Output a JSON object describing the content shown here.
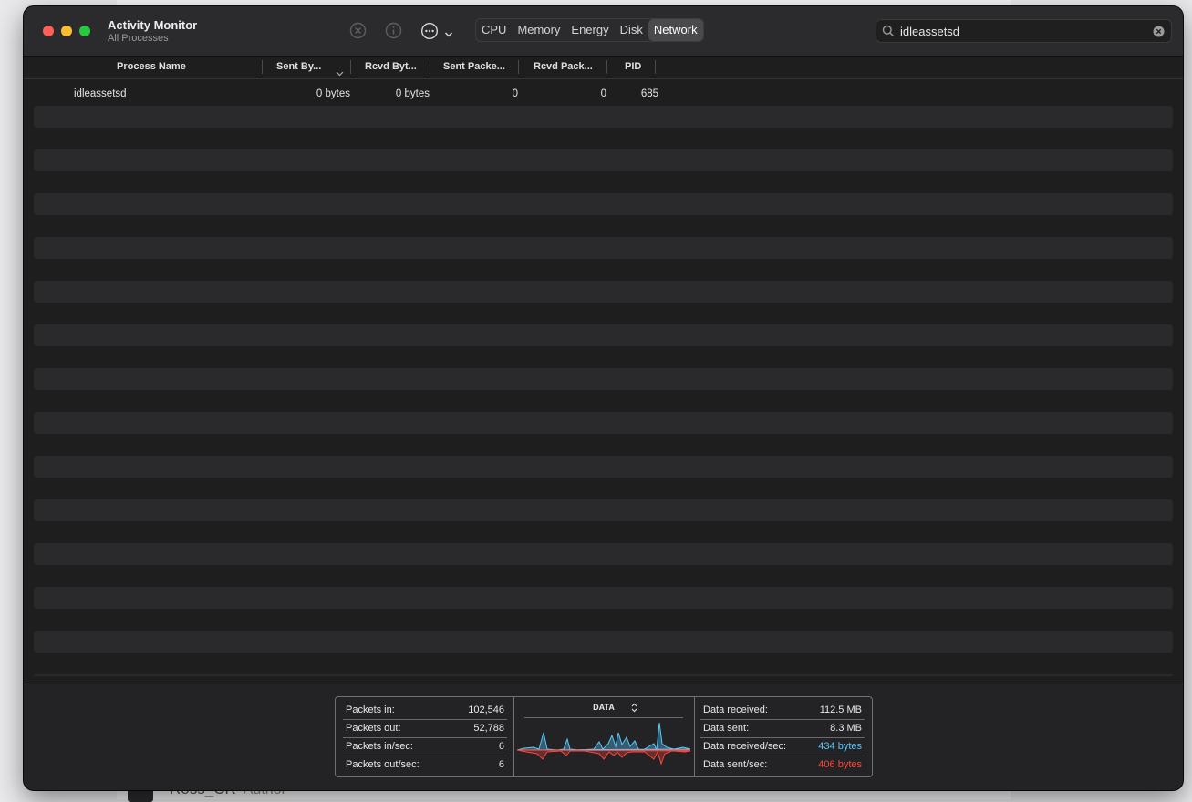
{
  "app": {
    "title": "Activity Monitor",
    "subtitle": "All Processes"
  },
  "toolbar": {
    "tabs": [
      {
        "label": "CPU",
        "active": false
      },
      {
        "label": "Memory",
        "active": false
      },
      {
        "label": "Energy",
        "active": false
      },
      {
        "label": "Disk",
        "active": false
      },
      {
        "label": "Network",
        "active": true
      }
    ]
  },
  "search": {
    "value": "idleassetsd",
    "placeholder": "Search"
  },
  "table": {
    "columns": [
      "Process Name",
      "Sent By...",
      "Rcvd Byt...",
      "Sent Packe...",
      "Rcvd Pack...",
      "PID"
    ],
    "sorted_column": "Sent By...",
    "rows": [
      [
        "idleassetsd",
        "0 bytes",
        "0 bytes",
        "0",
        "0",
        "685"
      ]
    ]
  },
  "footer": {
    "packets": [
      {
        "label": "Packets in:",
        "value": "102,546"
      },
      {
        "label": "Packets out:",
        "value": "52,788"
      },
      {
        "label": "Packets in/sec:",
        "value": "6"
      },
      {
        "label": "Packets out/sec:",
        "value": "6"
      }
    ],
    "graph_title": "DATA",
    "data": [
      {
        "label": "Data received:",
        "value": "112.5 MB"
      },
      {
        "label": "Data sent:",
        "value": "8.3 MB"
      },
      {
        "label": "Data received/sec:",
        "value": "434 bytes"
      },
      {
        "label": "Data sent/sec:",
        "value": "406 bytes"
      }
    ],
    "colors": {
      "received": "#5ac8fa",
      "sent": "#ff453a"
    }
  },
  "background": {
    "author_name": "Ross_CR",
    "author_role": "Author"
  }
}
